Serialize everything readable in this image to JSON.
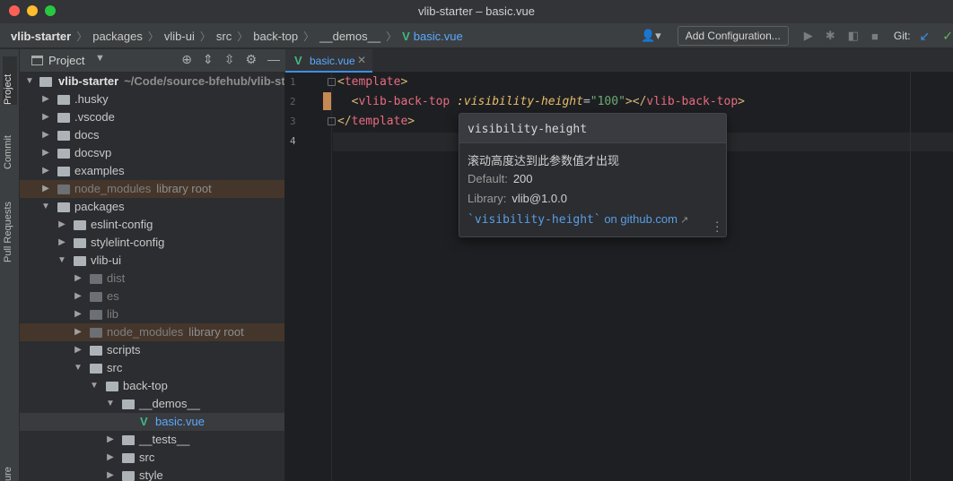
{
  "window": {
    "title": "vlib-starter – basic.vue"
  },
  "navbar": {
    "breadcrumbs": [
      "vlib-starter",
      "packages",
      "vlib-ui",
      "src",
      "back-top",
      "__demos__"
    ],
    "file": "basic.vue",
    "config_label": "Add Configuration...",
    "git_label": "Git:"
  },
  "left_strip": {
    "project": "Project",
    "commit": "Commit",
    "pull_requests": "Pull Requests",
    "structure": "ure"
  },
  "project_panel": {
    "title": "Project"
  },
  "tree": [
    {
      "label": "vlib-starter",
      "hint": "~/Code/source-bfehub/vlib-sta"
    },
    {
      "label": ".husky"
    },
    {
      "label": ".vscode"
    },
    {
      "label": "docs"
    },
    {
      "label": "docsvp"
    },
    {
      "label": "examples"
    },
    {
      "label": "node_modules",
      "hint": "library root"
    },
    {
      "label": "packages"
    },
    {
      "label": "eslint-config"
    },
    {
      "label": "stylelint-config"
    },
    {
      "label": "vlib-ui"
    },
    {
      "label": "dist"
    },
    {
      "label": "es"
    },
    {
      "label": "lib"
    },
    {
      "label": "node_modules",
      "hint": "library root"
    },
    {
      "label": "scripts"
    },
    {
      "label": "src"
    },
    {
      "label": "back-top"
    },
    {
      "label": "__demos__"
    },
    {
      "label": "basic.vue"
    },
    {
      "label": "__tests__"
    },
    {
      "label": "src"
    },
    {
      "label": "style"
    }
  ],
  "editor": {
    "tab": "basic.vue",
    "line_numbers": [
      "1",
      "2",
      "3",
      "4"
    ],
    "code": {
      "l1_open": "<",
      "l1_tag": "template",
      "l1_close": ">",
      "l2_indent": "  ",
      "l2_open": "<",
      "l2_tag": "vlib-back-top",
      "l2_attr": " :visibility-height",
      "l2_eq": "=",
      "l2_val": "\"100\"",
      "l2_mid": "></",
      "l2_tag2": "vlib-back-top",
      "l2_close": ">",
      "l3_open": "</",
      "l3_tag": "template",
      "l3_close": ">"
    }
  },
  "popup": {
    "title": "visibility-height",
    "description": "滚动高度达到此参数值才出现",
    "default_label": "Default:",
    "default_value": "200",
    "library_label": "Library:",
    "library_value": "vlib@1.0.0",
    "link_code": "`visibility-height`",
    "link_text": " on github.com"
  }
}
